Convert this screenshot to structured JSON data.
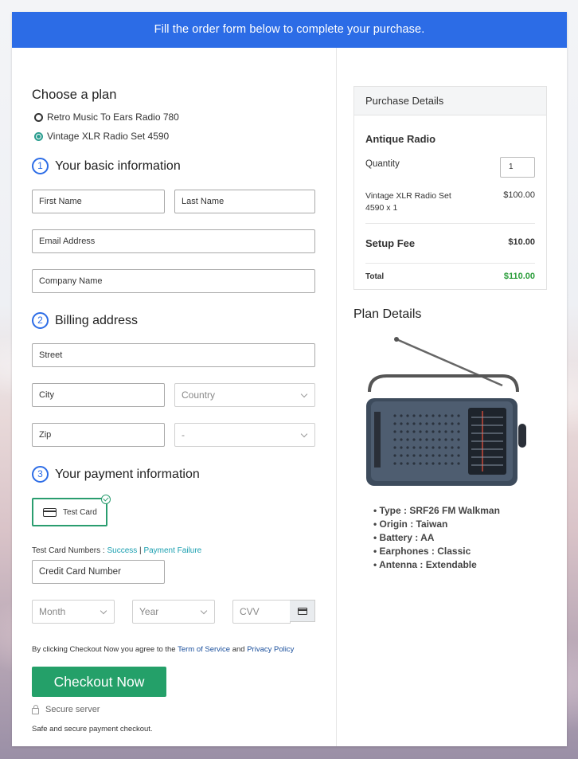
{
  "banner": {
    "text": "Fill the order form below to complete your purchase."
  },
  "plan": {
    "heading": "Choose a plan",
    "options": [
      {
        "label": "Retro Music To Ears Radio 780",
        "selected": false
      },
      {
        "label": "Vintage XLR Radio Set 4590",
        "selected": true
      }
    ]
  },
  "basic_info": {
    "step": "1",
    "title": "Your basic information",
    "first_name_placeholder": "First Name",
    "last_name_placeholder": "Last Name",
    "email_placeholder": "Email Address",
    "company_placeholder": "Company Name"
  },
  "billing": {
    "step": "2",
    "title": "Billing address",
    "street_placeholder": "Street",
    "city_placeholder": "City",
    "country_select": "Country",
    "zip_placeholder": "Zip",
    "state_select": "-"
  },
  "payment": {
    "step": "3",
    "title": "Your payment information",
    "test_card_label": "Test Card",
    "test_numbers_prefix": "Test Card Numbers : ",
    "success_link": "Success",
    "separator": " | ",
    "failure_link": "Payment Failure",
    "card_number_placeholder": "Credit Card Number",
    "month_select": "Month",
    "year_select": "Year",
    "cvv_placeholder": "CVV"
  },
  "terms": {
    "prefix": "By clicking Checkout Now you agree to the ",
    "terms_link": "Term of Service",
    "and": " and ",
    "privacy_link": "Privacy Policy"
  },
  "checkout": {
    "button_label": "Checkout Now",
    "secure_label": "Secure server",
    "safe_text": "Safe and secure payment checkout."
  },
  "purchase": {
    "heading": "Purchase Details",
    "product_title": "Antique Radio",
    "quantity_label": "Quantity",
    "quantity_value": "1",
    "item_line1": "Vintage XLR Radio Set",
    "item_line2": "4590 x 1",
    "item_price": "$100.00",
    "setup_fee_label": "Setup Fee",
    "setup_fee_value": "$10.00",
    "total_label": "Total",
    "total_value": "$110.00",
    "total_color": "#2a9d3a"
  },
  "plan_details": {
    "heading": "Plan Details",
    "specs": [
      "Type : SRF26 FM Walkman",
      "Origin : Taiwan",
      "Battery : AA",
      "Earphones : Classic",
      "Antenna : Extendable"
    ]
  },
  "colors": {
    "accent": "#2c6ce6",
    "checkout": "#24a069",
    "selected_radio": "#2a9d8f"
  }
}
